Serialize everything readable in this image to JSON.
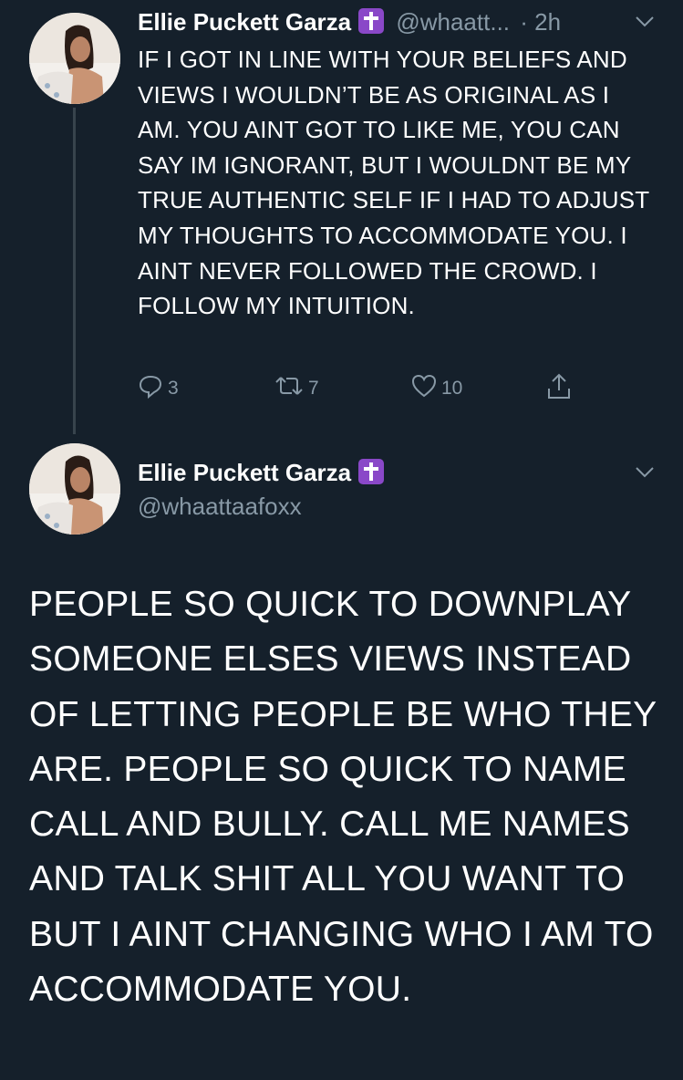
{
  "tweet1": {
    "display_name": "Ellie Puckett Garza",
    "handle": "@whaatt...",
    "time": "· 2h",
    "text": "IF I GOT IN LINE WITH YOUR BELIEFS AND VIEWS I WOULDN’T BE AS ORIGINAL AS I AM. YOU AINT GOT TO LIKE ME, YOU CAN SAY IM IGNORANT, BUT I WOULDNT BE MY TRUE AUTHENTIC SELF IF I HAD TO ADJUST MY THOUGHTS TO ACCOMMODATE YOU. I AINT NEVER FOLLOWED THE CROWD. I FOLLOW MY INTUITION.",
    "replies": "3",
    "retweets": "7",
    "likes": "10"
  },
  "tweet2": {
    "display_name": "Ellie Puckett Garza",
    "handle": "@whaattaafoxx",
    "text": "PEOPLE SO QUICK TO DOWNPLAY SOMEONE ELSES VIEWS INSTEAD OF LETTING PEOPLE BE WHO THEY ARE. PEOPLE SO QUICK TO NAME CALL AND BULLY. CALL ME NAMES AND TALK SHIT ALL YOU WANT TO BUT I AINT CHANGING WHO I AM TO ACCOMMODATE YOU."
  },
  "icons": {
    "verified_emoji": "latin-cross-icon",
    "reply": "reply-icon",
    "retweet": "retweet-icon",
    "like": "heart-icon",
    "share": "share-icon",
    "menu": "chevron-down-icon"
  },
  "colors": {
    "background": "#15202b",
    "secondary_text": "#8899a6",
    "thread_line": "#38444d",
    "cross_badge": "#8a48c8"
  }
}
